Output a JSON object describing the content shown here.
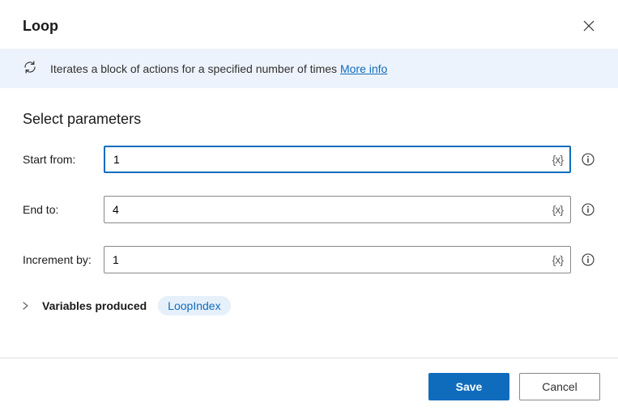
{
  "dialog": {
    "title": "Loop"
  },
  "banner": {
    "text": "Iterates a block of actions for a specified number of times",
    "more_info_label": "More info"
  },
  "section": {
    "title": "Select parameters"
  },
  "params": {
    "start": {
      "label": "Start from:",
      "value": "1"
    },
    "end": {
      "label": "End to:",
      "value": "4"
    },
    "increment": {
      "label": "Increment by:",
      "value": "1"
    }
  },
  "variable_token": "{x}",
  "variables": {
    "label": "Variables produced",
    "chip": "LoopIndex"
  },
  "buttons": {
    "save": "Save",
    "cancel": "Cancel"
  }
}
